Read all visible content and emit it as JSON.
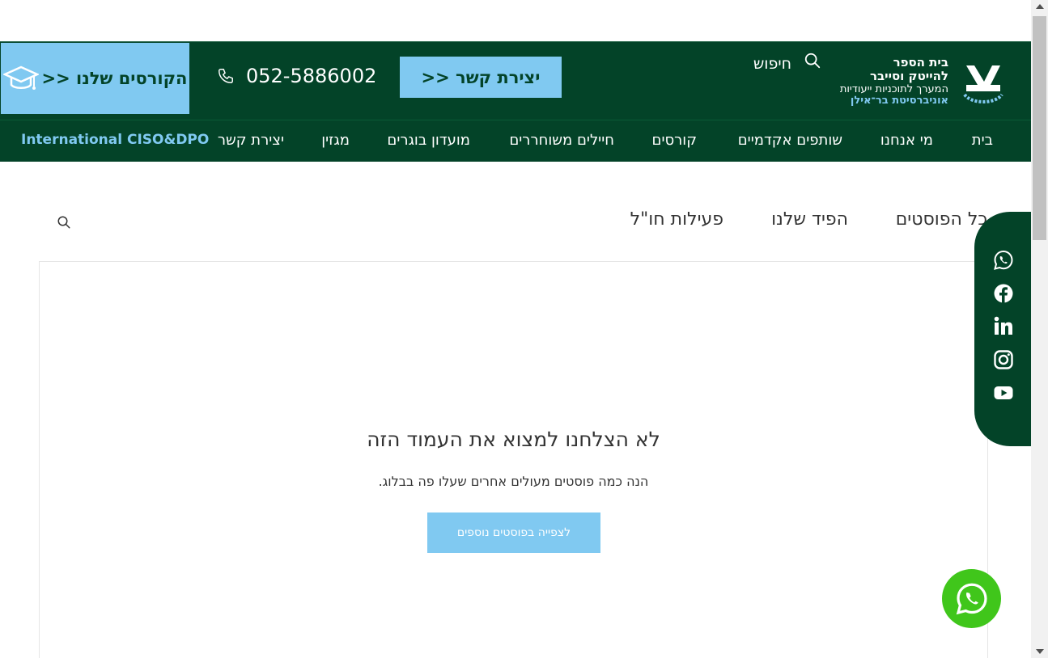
{
  "header": {
    "courses_button": "הקורסים שלנו <<",
    "phone": "052-5886002",
    "contact_button": "יצירת קשר <<",
    "search_label": "חיפוש",
    "logo": {
      "line1": "בית הספר",
      "line2": "להייטק וסייבר",
      "line3": "המערך לתוכניות ייעודיות",
      "line4": "אוניברסיטת בר־אילן"
    }
  },
  "nav": {
    "items": [
      "בית",
      "מי אנחנו",
      "שותפים אקדמיים",
      "קורסים",
      "חיילים משוחררים",
      "מועדון בוגרים",
      "מגזין",
      "יצירת קשר"
    ],
    "international": "International CISO&DPO"
  },
  "blog": {
    "tabs": [
      "כל הפוסטים",
      "הפיד שלנו",
      "פעילות חו\"ל"
    ],
    "not_found_title": "לא הצלחנו למצוא את העמוד הזה",
    "not_found_subtitle": "הנה כמה פוסטים מעולים אחרים שעלו פה בבלוג.",
    "more_posts_button": "לצפייה בפוסטים נוספים"
  },
  "social": {
    "icons": [
      "whatsapp-icon",
      "facebook-icon",
      "linkedin-icon",
      "instagram-icon",
      "youtube-icon"
    ]
  },
  "colors": {
    "brand_green": "#034328",
    "accent_blue": "#80c9f1",
    "whatsapp_green": "#40c61b"
  }
}
